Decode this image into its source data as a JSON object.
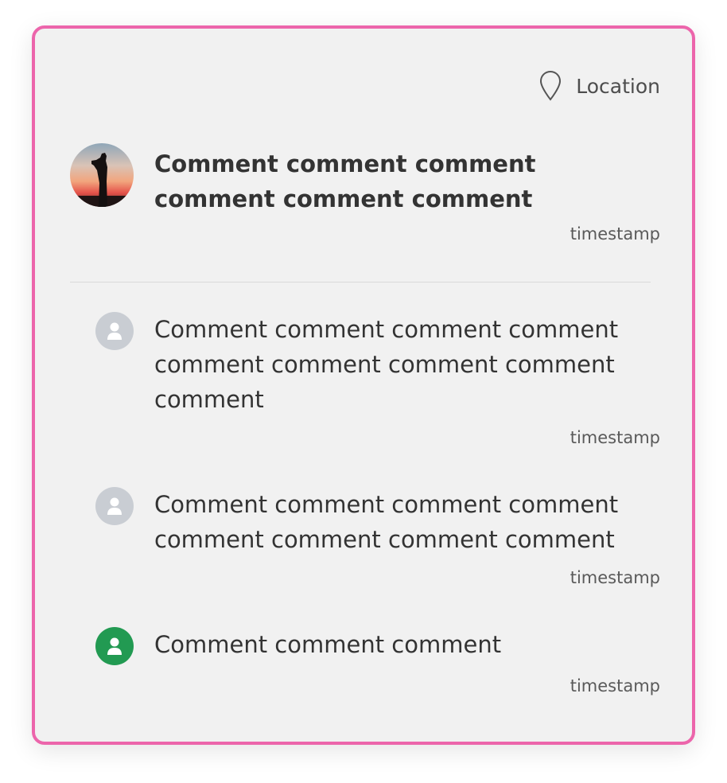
{
  "location": {
    "label": "Location",
    "icon": "map-pin-icon"
  },
  "main_comment": {
    "text": "Comment comment comment comment comment comment",
    "timestamp": "timestamp",
    "avatar": "photo-avatar"
  },
  "replies": [
    {
      "text": "Comment comment comment comment comment comment comment comment comment",
      "timestamp": "timestamp",
      "avatar_color": "#c9cdd3",
      "avatar_icon": "person-icon"
    },
    {
      "text": "Comment comment comment comment comment comment comment comment",
      "timestamp": "timestamp",
      "avatar_color": "#c9cdd3",
      "avatar_icon": "person-icon"
    },
    {
      "text": "Comment comment comment",
      "timestamp": "timestamp",
      "avatar_color": "#229a52",
      "avatar_icon": "person-icon"
    }
  ],
  "colors": {
    "border": "#ec65ab",
    "card_background": "#f1f1f1"
  }
}
